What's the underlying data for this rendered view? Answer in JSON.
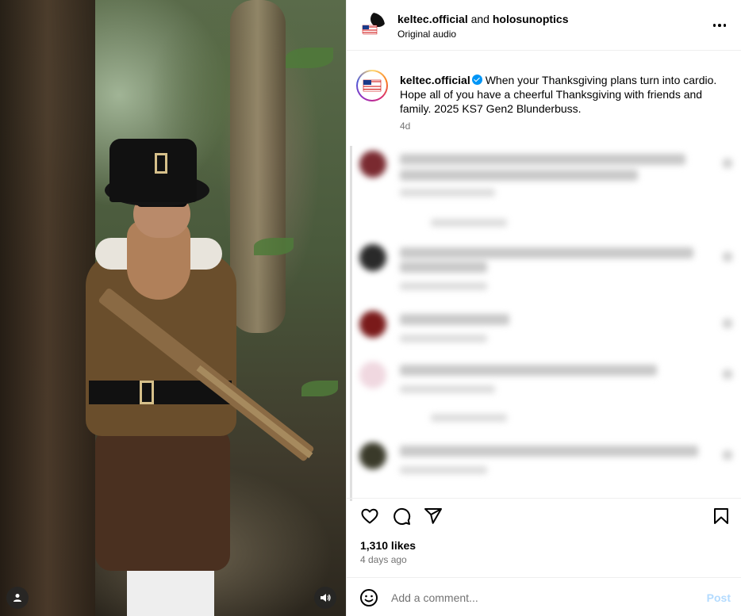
{
  "header": {
    "account_primary": "keltec.official",
    "joiner": "and",
    "account_secondary": "holosunoptics",
    "audio_label": "Original audio",
    "more_icon": "more-horizontal-icon"
  },
  "caption": {
    "username": "keltec.official",
    "text": "When your Thanksgiving plans turn into cardio. Hope all of you have a cheerful Thanksgiving with friends and family. 2025 KS7 Gen2 Blunderbuss.",
    "time": "4d",
    "verified": true
  },
  "media": {
    "profile_icon": "user-icon",
    "audio_icon": "speaker-icon"
  },
  "actions": {
    "like_icon": "heart-icon",
    "comment_icon": "comment-icon",
    "share_icon": "share-icon",
    "save_icon": "bookmark-icon"
  },
  "stats": {
    "likes": "1,310 likes",
    "posted": "4 days ago"
  },
  "composer": {
    "placeholder": "Add a comment...",
    "post_label": "Post",
    "emoji_icon": "emoji-icon"
  },
  "colors": {
    "link_blue": "#0095f6",
    "post_disabled": "#b3dbff",
    "muted_text": "#737373"
  }
}
